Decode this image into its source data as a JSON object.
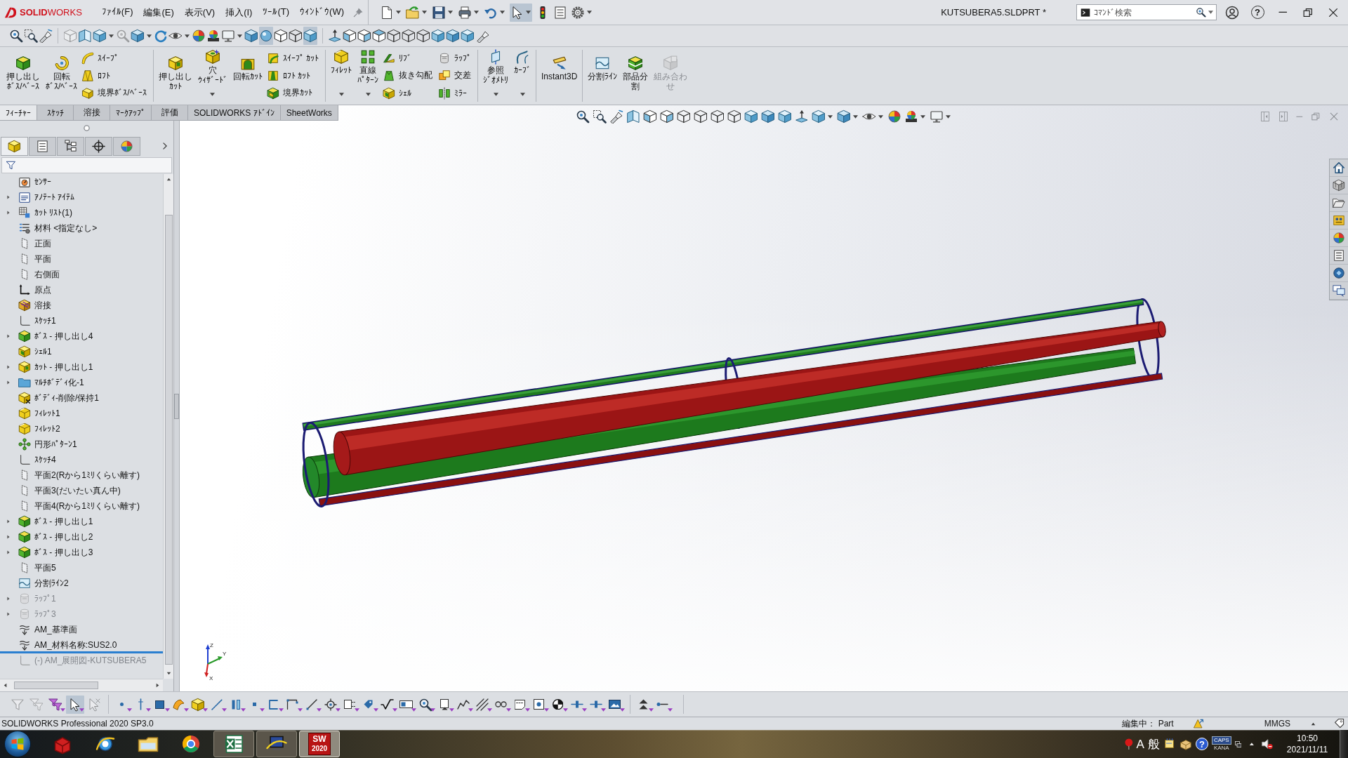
{
  "title_bar": {
    "logo": "**SOLID**WORKS",
    "menus": [
      "ﾌｧｲﾙ(F)",
      "編集(E)",
      "表示(V)",
      "挿入(I)",
      "ﾂｰﾙ(T)",
      "ｳｨﾝﾄﾞｳ(W)"
    ],
    "quick_access": [
      {
        "kind": "new",
        "dropdown": true,
        "selected": false
      },
      {
        "kind": "open",
        "dropdown": true,
        "selected": false
      },
      {
        "kind": "save",
        "dropdown": true,
        "selected": false
      },
      {
        "kind": "print",
        "dropdown": true,
        "selected": false
      },
      {
        "kind": "undo",
        "dropdown": true,
        "selected": false
      },
      {
        "kind": "pointer",
        "dropdown": true,
        "selected": true
      },
      {
        "kind": "rebuild",
        "dropdown": false,
        "selected": false
      },
      {
        "kind": "properties",
        "dropdown": false,
        "selected": false
      },
      {
        "kind": "gear",
        "dropdown": true,
        "selected": false
      }
    ],
    "document_title": "KUTSUBERA5.SLDPRT *",
    "search": {
      "placeholder": "ｺﾏﾝﾄﾞ検索"
    },
    "help": "?"
  },
  "view_toolbar": {
    "groups": [
      [
        {
          "kind": "zoom",
          "dropdown": false,
          "selected": false,
          "disabled": false
        },
        {
          "kind": "zoom-box",
          "dropdown": false,
          "selected": false,
          "disabled": false
        },
        {
          "kind": "prev-view",
          "dropdown": false,
          "selected": false,
          "disabled": false
        }
      ],
      [
        {
          "kind": "cube-dashed",
          "dropdown": false,
          "selected": false,
          "disabled": true
        },
        {
          "kind": "section",
          "dropdown": false,
          "selected": false,
          "disabled": false
        },
        {
          "kind": "cube",
          "dropdown": true,
          "selected": false,
          "disabled": false
        },
        {
          "kind": "zoom",
          "dropdown": false,
          "selected": false,
          "disabled": true
        },
        {
          "kind": "cube-shaded",
          "dropdown": true,
          "selected": false,
          "disabled": false
        },
        {
          "kind": "rotate",
          "dropdown": false,
          "selected": false,
          "disabled": false
        },
        {
          "kind": "eye",
          "dropdown": true,
          "selected": false,
          "disabled": false
        },
        {
          "kind": "sphere-color",
          "dropdown": false,
          "selected": false,
          "disabled": false
        },
        {
          "kind": "scene",
          "dropdown": false,
          "selected": false,
          "disabled": false
        },
        {
          "kind": "monitor",
          "dropdown": true,
          "selected": false,
          "disabled": false
        },
        {
          "kind": "cube-shaded",
          "dropdown": false,
          "selected": false,
          "disabled": false
        },
        {
          "kind": "sphere",
          "dropdown": false,
          "selected": true,
          "disabled": false
        },
        {
          "kind": "cube-dashed",
          "dropdown": false,
          "selected": false,
          "disabled": false
        },
        {
          "kind": "cube-wire",
          "dropdown": false,
          "selected": false,
          "disabled": false
        },
        {
          "kind": "cube",
          "dropdown": false,
          "selected": true,
          "disabled": false
        }
      ],
      [
        {
          "kind": "normal",
          "dropdown": false,
          "selected": false,
          "disabled": false
        },
        {
          "kind": "cube-front",
          "dropdown": false,
          "selected": false,
          "disabled": false
        },
        {
          "kind": "cube-right",
          "dropdown": false,
          "selected": false,
          "disabled": false
        },
        {
          "kind": "cube-top",
          "dropdown": false,
          "selected": false,
          "disabled": false
        },
        {
          "kind": "cube-wire",
          "dropdown": false,
          "selected": false,
          "disabled": false
        },
        {
          "kind": "cube-wire",
          "dropdown": false,
          "selected": false,
          "disabled": false
        },
        {
          "kind": "cube-wire",
          "dropdown": false,
          "selected": false,
          "disabled": false
        },
        {
          "kind": "cube",
          "dropdown": false,
          "selected": false,
          "disabled": false
        },
        {
          "kind": "cube-shaded",
          "dropdown": false,
          "selected": false,
          "disabled": false
        },
        {
          "kind": "cube",
          "dropdown": false,
          "selected": false,
          "disabled": false
        },
        {
          "kind": "flashlight",
          "dropdown": false,
          "selected": false,
          "disabled": false
        }
      ]
    ]
  },
  "command_manager": {
    "groups": [
      [
        {
          "kind": "large",
          "lines": [
            "押し出し",
            "ﾎﾞｽ/ﾍﾞｰｽ"
          ],
          "dropdown": false,
          "disabled": false
        },
        {
          "kind": "large",
          "lines": [
            "回転",
            "ﾎﾞｽ/ﾍﾞｰｽ"
          ],
          "dropdown": false,
          "disabled": false
        },
        {
          "kind": "stack",
          "items": [
            "ｽｲｰﾌﾟ",
            "ﾛﾌﾄ",
            "境界ﾎﾞｽ/ﾍﾞｰｽ"
          ]
        }
      ],
      [
        {
          "kind": "large",
          "lines": [
            "押し出し",
            "ｶｯﾄ"
          ],
          "dropdown": false,
          "disabled": false
        },
        {
          "kind": "large",
          "lines": [
            "穴",
            "ｳｨｻﾞｰﾄﾞ"
          ],
          "dropdown": true,
          "disabled": false
        },
        {
          "kind": "large",
          "lines": [
            "回転ｶｯﾄ"
          ],
          "dropdown": false,
          "disabled": false
        },
        {
          "kind": "stack",
          "items": [
            "ｽｲｰﾌﾟ ｶｯﾄ",
            "ﾛﾌﾄ ｶｯﾄ",
            "境界ｶｯﾄ"
          ]
        }
      ],
      [
        {
          "kind": "large",
          "lines": [
            "ﾌｨﾚｯﾄ"
          ],
          "dropdown": true,
          "disabled": false
        },
        {
          "kind": "large",
          "lines": [
            "直線",
            "ﾊﾟﾀｰﾝ"
          ],
          "dropdown": true,
          "disabled": false
        },
        {
          "kind": "stack",
          "items": [
            "ﾘﾌﾞ",
            "抜き勾配",
            "ｼｪﾙ"
          ]
        },
        {
          "kind": "stack",
          "items": [
            "ﾗｯﾌﾟ",
            "交差",
            "ﾐﾗｰ"
          ]
        }
      ],
      [
        {
          "kind": "large",
          "lines": [
            "参照",
            "ｼﾞｵﾒﾄﾘ"
          ],
          "dropdown": true,
          "disabled": false
        },
        {
          "kind": "large",
          "lines": [
            "ｶｰﾌﾞ"
          ],
          "dropdown": true,
          "disabled": false
        }
      ],
      [
        {
          "kind": "large",
          "lines": [
            "Instant3D"
          ],
          "dropdown": false,
          "disabled": false
        }
      ],
      [
        {
          "kind": "large",
          "lines": [
            "分割ﾗｲﾝ"
          ],
          "dropdown": false,
          "disabled": false
        },
        {
          "kind": "large",
          "lines": [
            "部品分",
            "割"
          ],
          "dropdown": false,
          "disabled": false
        },
        {
          "kind": "large",
          "lines": [
            "組み合わ",
            "せ"
          ],
          "dropdown": false,
          "disabled": true
        }
      ]
    ],
    "tabs": [
      {
        "label": "ﾌｨｰﾁｬｰ",
        "selected": true
      },
      {
        "label": "ｽｹｯﾁ",
        "selected": false
      },
      {
        "label": "溶接",
        "selected": false
      },
      {
        "label": "ﾏｰｸｱｯﾌﾟ",
        "selected": false
      },
      {
        "label": "評価",
        "selected": false
      },
      {
        "label": "SOLIDWORKS ｱﾄﾞｲﾝ",
        "selected": false
      },
      {
        "label": "SheetWorks",
        "selected": false
      }
    ]
  },
  "feature_manager": {
    "panel_tabs": [
      {
        "selected": true
      },
      {
        "selected": false
      },
      {
        "selected": false
      },
      {
        "selected": false
      },
      {
        "selected": false
      }
    ],
    "tree": [
      {
        "kind": "sensor",
        "label": "ｾﾝｻｰ",
        "collapsed": false,
        "suppressed": false
      },
      {
        "kind": "annotation",
        "label": "ｱﾉﾃｰﾄ ｱｲﾃﾑ",
        "collapsed": true,
        "suppressed": false
      },
      {
        "kind": "cutlist",
        "label": "ｶｯﾄ ﾘｽﾄ(1)",
        "collapsed": true,
        "suppressed": false
      },
      {
        "kind": "material",
        "label": "材料 <指定なし>",
        "collapsed": false,
        "suppressed": false
      },
      {
        "kind": "plane",
        "label": "正面",
        "collapsed": false,
        "suppressed": false
      },
      {
        "kind": "plane",
        "label": "平面",
        "collapsed": false,
        "suppressed": false
      },
      {
        "kind": "plane",
        "label": "右側面",
        "collapsed": false,
        "suppressed": false
      },
      {
        "kind": "origin",
        "label": "原点",
        "collapsed": false,
        "suppressed": false
      },
      {
        "kind": "weldment",
        "label": "溶接",
        "collapsed": false,
        "suppressed": false
      },
      {
        "kind": "sketch",
        "label": "ｽｹｯﾁ1",
        "collapsed": false,
        "suppressed": false
      },
      {
        "kind": "boss",
        "label": "ﾎﾞｽ - 押し出し4",
        "collapsed": true,
        "suppressed": false
      },
      {
        "kind": "shell",
        "label": "ｼｪﾙ1",
        "collapsed": false,
        "suppressed": false
      },
      {
        "kind": "cut",
        "label": "ｶｯﾄ - 押し出し1",
        "collapsed": true,
        "suppressed": false
      },
      {
        "kind": "folder",
        "label": "ﾏﾙﾁﾎﾞﾃﾞｨ化-1",
        "collapsed": true,
        "suppressed": false
      },
      {
        "kind": "delete-body",
        "label": "ﾎﾞﾃﾞｨ-削除/保持1",
        "collapsed": false,
        "suppressed": false
      },
      {
        "kind": "fillet",
        "label": "ﾌｨﾚｯﾄ1",
        "collapsed": false,
        "suppressed": false
      },
      {
        "kind": "fillet",
        "label": "ﾌｨﾚｯﾄ2",
        "collapsed": false,
        "suppressed": false
      },
      {
        "kind": "pattern",
        "label": "円形ﾊﾟﾀｰﾝ1",
        "collapsed": false,
        "suppressed": false
      },
      {
        "kind": "sketch",
        "label": "ｽｹｯﾁ4",
        "collapsed": false,
        "suppressed": false
      },
      {
        "kind": "plane",
        "label": "平面2(Rから1ﾐﾘくらい離す)",
        "collapsed": false,
        "suppressed": false
      },
      {
        "kind": "plane",
        "label": "平面3(だいたい真ん中)",
        "collapsed": false,
        "suppressed": false
      },
      {
        "kind": "plane",
        "label": "平面4(Rから1ﾐﾘくらい離す)",
        "collapsed": false,
        "suppressed": false
      },
      {
        "kind": "boss",
        "label": "ﾎﾞｽ - 押し出し1",
        "collapsed": true,
        "suppressed": false
      },
      {
        "kind": "boss",
        "label": "ﾎﾞｽ - 押し出し2",
        "collapsed": true,
        "suppressed": false
      },
      {
        "kind": "boss",
        "label": "ﾎﾞｽ - 押し出し3",
        "collapsed": true,
        "suppressed": false
      },
      {
        "kind": "plane",
        "label": "平面5",
        "collapsed": false,
        "suppressed": false
      },
      {
        "kind": "split-line",
        "label": "分割ﾗｲﾝ2",
        "collapsed": false,
        "suppressed": false
      },
      {
        "kind": "wrap",
        "label": "ﾗｯﾌﾟ1",
        "collapsed": true,
        "suppressed": true
      },
      {
        "kind": "wrap",
        "label": "ﾗｯﾌﾟ3",
        "collapsed": true,
        "suppressed": true
      },
      {
        "kind": "am",
        "label": "AM_基準面",
        "collapsed": false,
        "suppressed": false
      },
      {
        "kind": "am",
        "label": "AM_材料名称:SUS2.0",
        "collapsed": false,
        "suppressed": false
      }
    ],
    "rolled_back": [
      {
        "kind": "sketch",
        "label": "(-) AM_展開図-KUTSUBERA5",
        "collapsed": false,
        "suppressed": true
      }
    ]
  },
  "graphics_area": {
    "heads_up_toolbar": [
      {
        "kind": "zoom",
        "dropdown": false
      },
      {
        "kind": "zoom-box",
        "dropdown": false
      },
      {
        "kind": "prev-view",
        "dropdown": false
      },
      {
        "kind": "section",
        "dropdown": false
      },
      {
        "kind": "cube-front",
        "dropdown": false
      },
      {
        "kind": "cube-right",
        "dropdown": false
      },
      {
        "kind": "cube-wire",
        "dropdown": false
      },
      {
        "kind": "cube-wire",
        "dropdown": false
      },
      {
        "kind": "cube-wire",
        "dropdown": false
      },
      {
        "kind": "cube-wire",
        "dropdown": false
      },
      {
        "kind": "cube",
        "dropdown": false
      },
      {
        "kind": "cube-shaded",
        "dropdown": false
      },
      {
        "kind": "cube",
        "dropdown": false
      },
      {
        "kind": "normal",
        "dropdown": false
      },
      {
        "kind": "cube",
        "dropdown": true
      },
      {
        "kind": "cube-shaded",
        "dropdown": true
      },
      {
        "kind": "eye",
        "dropdown": true
      },
      {
        "kind": "sphere-color",
        "dropdown": false
      },
      {
        "kind": "scene",
        "dropdown": true
      },
      {
        "kind": "monitor",
        "dropdown": true
      }
    ],
    "triad": {
      "z": "Z",
      "y": "Y",
      "x": "X"
    }
  },
  "selection_toolbar": {
    "groups": [
      [
        {
          "kind": "funnel",
          "dropdown": false,
          "selected": false,
          "disabled": true
        },
        {
          "kind": "funnel-stack",
          "dropdown": false,
          "selected": false,
          "disabled": true
        },
        {
          "kind": "funnel-color",
          "dropdown": true,
          "selected": false,
          "disabled": false
        },
        {
          "kind": "pointer",
          "dropdown": true,
          "selected": true,
          "disabled": false
        },
        {
          "kind": "pointer-x",
          "dropdown": false,
          "selected": false,
          "disabled": true
        }
      ],
      [
        {
          "kind": "sel-dot",
          "dropdown": true,
          "selected": false,
          "disabled": false
        },
        {
          "kind": "sel-axis",
          "dropdown": true,
          "selected": false,
          "disabled": false
        },
        {
          "kind": "sel-face",
          "dropdown": true,
          "selected": false,
          "disabled": false
        },
        {
          "kind": "sel-surface",
          "dropdown": true,
          "selected": false,
          "disabled": false
        },
        {
          "kind": "sel-solid",
          "dropdown": true,
          "selected": false,
          "disabled": false
        },
        {
          "kind": "sel-line",
          "dropdown": true,
          "selected": false,
          "disabled": false
        },
        {
          "kind": "sel-plane",
          "dropdown": true,
          "selected": false,
          "disabled": false
        },
        {
          "kind": "sel-vertex",
          "dropdown": true,
          "selected": false,
          "disabled": false
        },
        {
          "kind": "bracket",
          "dropdown": true,
          "selected": false,
          "disabled": false
        },
        {
          "kind": "corner",
          "dropdown": true,
          "selected": false,
          "disabled": false
        },
        {
          "kind": "diag",
          "dropdown": true,
          "selected": false,
          "disabled": false
        },
        {
          "kind": "target",
          "dropdown": true,
          "selected": false,
          "disabled": false
        },
        {
          "kind": "dimbox",
          "dropdown": true,
          "selected": false,
          "disabled": false
        },
        {
          "kind": "tag",
          "dropdown": true,
          "selected": false,
          "disabled": false
        },
        {
          "kind": "check",
          "dropdown": true,
          "selected": false,
          "disabled": false
        },
        {
          "kind": "labelbox",
          "dropdown": true,
          "selected": false,
          "disabled": false
        },
        {
          "kind": "zoom",
          "dropdown": true,
          "selected": false,
          "disabled": false
        },
        {
          "kind": "anchor",
          "dropdown": true,
          "selected": false,
          "disabled": false
        },
        {
          "kind": "wave",
          "dropdown": true,
          "selected": false,
          "disabled": false
        },
        {
          "kind": "hatch",
          "dropdown": true,
          "selected": false,
          "disabled": false
        },
        {
          "kind": "glasses",
          "dropdown": true,
          "selected": false,
          "disabled": false
        },
        {
          "kind": "tray",
          "dropdown": true,
          "selected": false,
          "disabled": false
        },
        {
          "kind": "frame-dot",
          "dropdown": true,
          "selected": false,
          "disabled": false
        },
        {
          "kind": "ball",
          "dropdown": true,
          "selected": false,
          "disabled": false
        },
        {
          "kind": "slider",
          "dropdown": true,
          "selected": false,
          "disabled": false
        },
        {
          "kind": "slider",
          "dropdown": true,
          "selected": false,
          "disabled": false
        },
        {
          "kind": "photo",
          "dropdown": true,
          "selected": false,
          "disabled": false
        }
      ],
      [
        {
          "kind": "tri-stack",
          "dropdown": true,
          "selected": false,
          "disabled": false
        },
        {
          "kind": "dot-branch",
          "dropdown": true,
          "selected": false,
          "disabled": false
        }
      ]
    ]
  },
  "status_bar": {
    "product": "SOLIDWORKS Professional 2020 SP3.0",
    "mode": "編集中： Part",
    "units": "MMGS"
  },
  "taskbar": {
    "apps": [
      {
        "kind": "toolbox",
        "running": false,
        "selected": false
      },
      {
        "kind": "browser",
        "running": false,
        "selected": false
      },
      {
        "kind": "explorer",
        "running": false,
        "selected": false
      },
      {
        "kind": "chrome",
        "running": false,
        "selected": false
      },
      {
        "kind": "excel",
        "running": true,
        "selected": false
      },
      {
        "kind": "remote",
        "running": true,
        "selected": false
      },
      {
        "kind": "solidworks",
        "running": true,
        "selected": true,
        "label": "SW",
        "sublabel": "2020"
      }
    ],
    "tray": {
      "ime_mode": "A",
      "ime_char": "般",
      "help": "?",
      "caps": "CAPS",
      "kana": "KANA"
    },
    "clock": {
      "time": "10:50",
      "date": "2021/11/11"
    }
  }
}
